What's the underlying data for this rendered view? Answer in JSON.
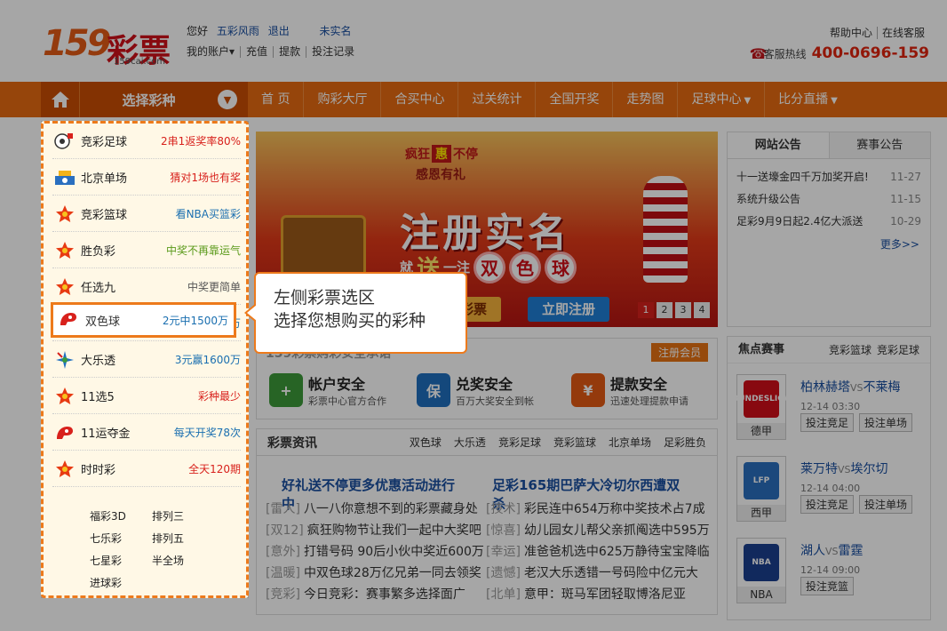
{
  "header": {
    "logo_number": "159",
    "logo_text": "彩票",
    "logo_sub": "159cai.com",
    "greeting": "您好",
    "username": "五彩风雨",
    "logout": "退出",
    "unverified": "未实名",
    "account_links": [
      "我的账户",
      "充值",
      "提款",
      "投注记录"
    ],
    "help_links": [
      "帮助中心",
      "在线客服"
    ],
    "hotline_label": "客服热线",
    "hotline_number": "400-0696-159"
  },
  "nav": {
    "select_label": "选择彩种",
    "items": [
      "首 页",
      "购彩大厅",
      "合买中心",
      "过关统计",
      "全国开奖",
      "走势图",
      "足球中心",
      "比分直播"
    ],
    "dropdown_flags": [
      false,
      false,
      false,
      false,
      false,
      false,
      true,
      true
    ]
  },
  "sidebar": {
    "lotteries": [
      {
        "name": "竞彩足球",
        "promo": "2串1返奖率80%",
        "color": "#d8211c",
        "icon": "soccer-icon"
      },
      {
        "name": "北京单场",
        "promo": "猜对1场也有奖",
        "color": "#d8211c",
        "icon": "bjdc-icon"
      },
      {
        "name": "竞彩篮球",
        "promo": "看NBA买篮彩",
        "color": "#1a6fb0",
        "icon": "star-badge-icon"
      },
      {
        "name": "胜负彩",
        "promo": "中奖不再靠运气",
        "color": "#5a9a1a",
        "icon": "star-badge-icon"
      },
      {
        "name": "任选九",
        "promo": "中奖更简单",
        "color": "#555555",
        "icon": "star-badge-icon"
      },
      {
        "name": "双色球",
        "promo": "2元中1500万",
        "color": "#1a6fb0",
        "icon": "fucai-icon"
      },
      {
        "name": "大乐透",
        "promo": "3元赢1600万",
        "color": "#1a6fb0",
        "icon": "ticai-icon"
      },
      {
        "name": "11选5",
        "promo": "彩种最少",
        "color": "#d8211c",
        "icon": "star-badge-icon"
      },
      {
        "name": "11运夺金",
        "promo": "每天开奖78次",
        "color": "#1a6fb0",
        "icon": "fucai-icon"
      },
      {
        "name": "时时彩",
        "promo": "全天120期",
        "color": "#d8211c",
        "icon": "star-badge-icon"
      }
    ],
    "extras": [
      "福彩3D",
      "排列三",
      "七乐彩",
      "排列五",
      "七星彩",
      "半全场",
      "进球彩"
    ]
  },
  "banner": {
    "slogan_a": "疯狂",
    "slogan_hui": "惠",
    "slogan_b": "不停",
    "subtitle": "感恩有礼",
    "title": "注册实名",
    "gift_a": "就",
    "gift_song": "送",
    "gift_b": "一注",
    "balls": [
      "双",
      "色",
      "球"
    ],
    "btn_claim": "领取彩票",
    "btn_register": "立即注册",
    "pages": [
      "1",
      "2",
      "3",
      "4"
    ]
  },
  "notice": {
    "tabs": [
      "网站公告",
      "赛事公告"
    ],
    "items": [
      {
        "title": "十一送壕金四千万加奖开启!",
        "date": "11-27"
      },
      {
        "title": "系统升级公告",
        "date": "11-15"
      },
      {
        "title": "足彩9月9日起2.4亿大派送",
        "date": "10-29"
      }
    ],
    "more": "更多>>"
  },
  "safety": {
    "heading": "159彩票购彩安全承诺",
    "register": "注册会员",
    "items": [
      {
        "title": "帐户安全",
        "desc": "彩票中心官方合作",
        "color": "#3c9a3a",
        "glyph": "+"
      },
      {
        "title": "兑奖安全",
        "desc": "百万大奖安全到帐",
        "color": "#1f6fbf",
        "glyph": "保"
      },
      {
        "title": "提款安全",
        "desc": "迅速处理提款申请",
        "color": "#e35a13",
        "glyph": "¥"
      }
    ]
  },
  "news": {
    "title": "彩票资讯",
    "categories": [
      "双色球",
      "大乐透",
      "竞彩足球",
      "竞彩篮球",
      "北京单场",
      "足彩胜负"
    ],
    "headlines": [
      "好礼送不停更多优惠活动进行中",
      "足彩165期巴萨大冷切尔西遭双杀"
    ],
    "left": [
      {
        "tag": "[雷人]",
        "text": "八一八你意想不到的彩票藏身处"
      },
      {
        "tag": "[双12]",
        "text": "疯狂购物节让我们一起中大奖吧"
      },
      {
        "tag": "[意外]",
        "text": "打错号码 90后小伙中奖近600万"
      },
      {
        "tag": "[温暖]",
        "text": "中双色球28万亿兄弟一同去领奖"
      },
      {
        "tag": "[竞彩]",
        "text": "今日竞彩：赛事繁多选择面广"
      }
    ],
    "right": [
      {
        "tag": "[技术]",
        "text": "彩民连中654万称中奖技术占7成"
      },
      {
        "tag": "[惊喜]",
        "text": "幼儿园女儿帮父亲抓阄选中595万"
      },
      {
        "tag": "[幸运]",
        "text": "准爸爸机选中625万静待宝宝降临"
      },
      {
        "tag": "[遗憾]",
        "text": "老汉大乐透错一号码险中亿元大"
      },
      {
        "tag": "[北单]",
        "text": "意甲：斑马军团轻取博洛尼亚"
      }
    ]
  },
  "focus": {
    "title": "焦点赛事",
    "cats": [
      "竞彩篮球",
      "竞彩足球"
    ],
    "matches": [
      {
        "home": "柏林赫塔",
        "vs": "VS",
        "away": "不莱梅",
        "time": "12-14 03:30",
        "league": "德甲",
        "emblem": "BUNDESLIGA",
        "emblem_color": "#d20f1a",
        "buttons": [
          "投注竞足",
          "投注单场"
        ]
      },
      {
        "home": "莱万特",
        "vs": "VS",
        "away": "埃尔切",
        "time": "12-14 04:00",
        "league": "西甲",
        "emblem": "LFP",
        "emblem_color": "#2a6fbf",
        "buttons": [
          "投注竞足",
          "投注单场"
        ]
      },
      {
        "home": "湖人",
        "vs": "VS",
        "away": "雷霆",
        "time": "12-14 09:00",
        "league": "NBA",
        "emblem": "NBA",
        "emblem_color": "#1b3f8f",
        "buttons": [
          "投注竞篮"
        ]
      }
    ]
  },
  "tooltip": {
    "line1": "左侧彩票选区",
    "line2": "选择您想购买的彩种"
  }
}
